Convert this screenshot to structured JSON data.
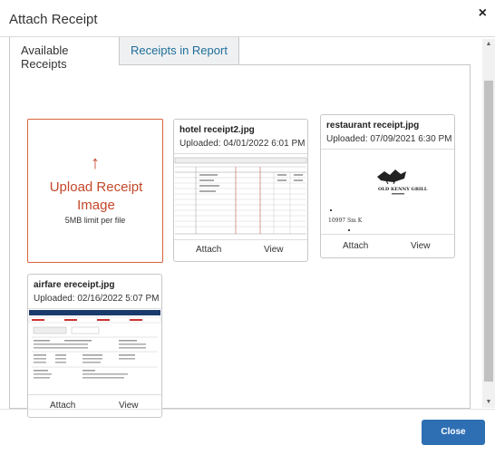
{
  "dialog": {
    "title": "Attach Receipt",
    "close_glyph": "×"
  },
  "tabs": [
    {
      "label": "Available Receipts",
      "active": true
    },
    {
      "label": "Receipts in Report",
      "active": false
    }
  ],
  "upload": {
    "icon": "upload-arrow-icon",
    "icon_glyph": "↑",
    "label": "Upload Receipt Image",
    "limit": "5MB limit per file"
  },
  "receipts": [
    {
      "filename": "hotel receipt2.jpg",
      "uploaded": "Uploaded: 04/01/2022 6:01 PM",
      "attach_label": "Attach",
      "view_label": "View"
    },
    {
      "filename": "restaurant receipt.jpg",
      "uploaded": "Uploaded: 07/09/2021 6:30 PM",
      "attach_label": "Attach",
      "view_label": "View",
      "thumb_text": [
        "OLD KENNY GRILL",
        "10997 Sm K"
      ]
    },
    {
      "filename": "airfare ereceipt.jpg",
      "uploaded": "Uploaded: 02/16/2022 5:07 PM",
      "attach_label": "Attach",
      "view_label": "View"
    }
  ],
  "footer": {
    "close_label": "Close"
  },
  "colors": {
    "accent": "#c4472a",
    "button": "#2e6fb4",
    "tab_link": "#1f6e9a"
  }
}
